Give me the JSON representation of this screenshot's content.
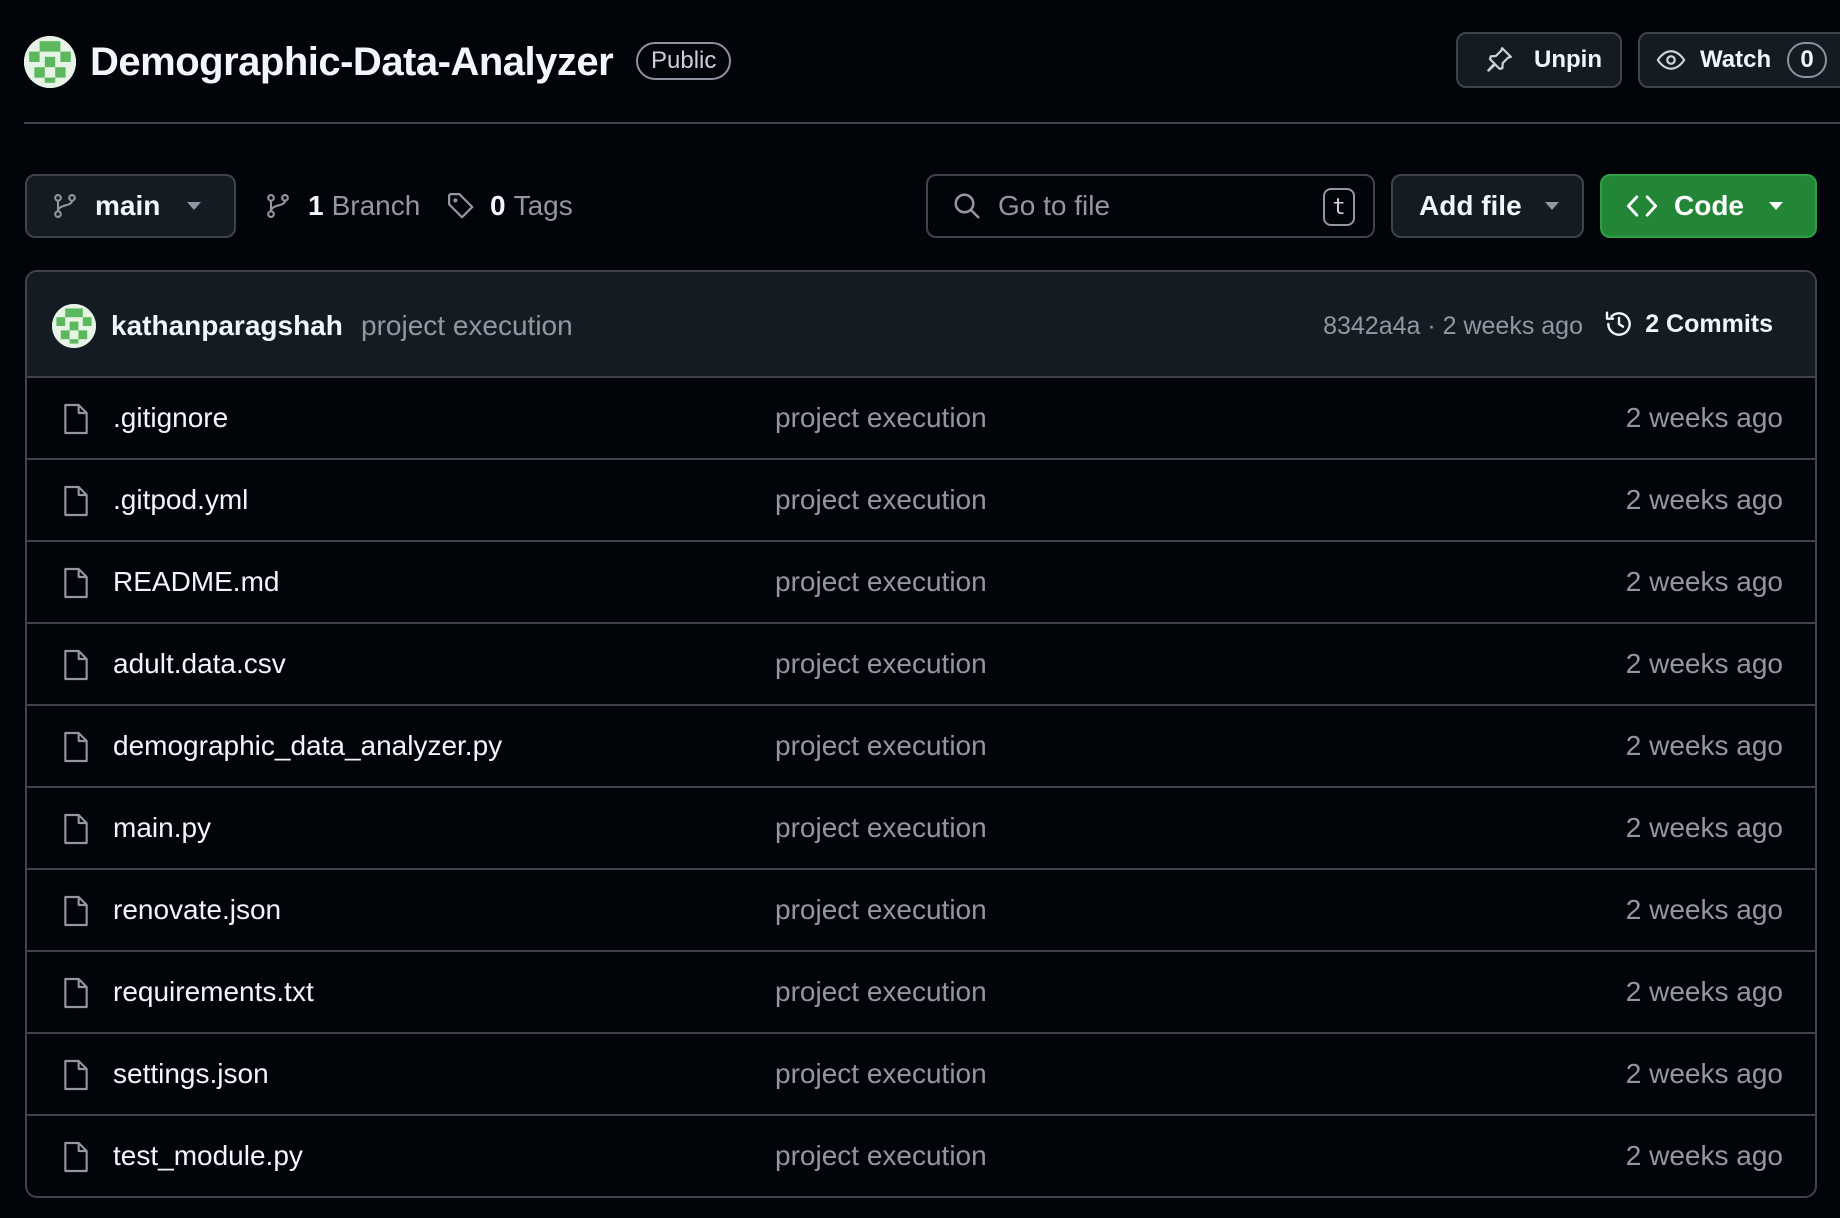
{
  "colors": {
    "background": "#010409",
    "surface": "#151b23",
    "border": "#3d444d",
    "text_primary": "#f0f6fc",
    "text_muted": "#9198a1",
    "code_button": "#238636"
  },
  "repo": {
    "name": "Demographic-Data-Analyzer",
    "visibility": "Public",
    "avatar_icon": "identicon"
  },
  "actions": {
    "unpin_label": "Unpin",
    "unpin_icon": "pin-icon",
    "watch_label": "Watch",
    "watch_icon": "eye-icon",
    "watch_count": "0"
  },
  "toolbar": {
    "branch": "main",
    "branch_count": "1",
    "branch_label": "Branch",
    "tag_count": "0",
    "tag_label": "Tags",
    "search_placeholder": "Go to file",
    "search_value": "",
    "search_shortcut": "t",
    "add_file_label": "Add file",
    "code_label": "Code"
  },
  "latest_commit": {
    "author": "kathanparagshah",
    "message": "project execution",
    "hash_and_time": "8342a4a · 2 weeks ago",
    "commits_label": "2 Commits"
  },
  "files": [
    {
      "name": ".gitignore",
      "commit": "project execution",
      "updated": "2 weeks ago"
    },
    {
      "name": ".gitpod.yml",
      "commit": "project execution",
      "updated": "2 weeks ago"
    },
    {
      "name": "README.md",
      "commit": "project execution",
      "updated": "2 weeks ago"
    },
    {
      "name": "adult.data.csv",
      "commit": "project execution",
      "updated": "2 weeks ago"
    },
    {
      "name": "demographic_data_analyzer.py",
      "commit": "project execution",
      "updated": "2 weeks ago"
    },
    {
      "name": "main.py",
      "commit": "project execution",
      "updated": "2 weeks ago"
    },
    {
      "name": "renovate.json",
      "commit": "project execution",
      "updated": "2 weeks ago"
    },
    {
      "name": "requirements.txt",
      "commit": "project execution",
      "updated": "2 weeks ago"
    },
    {
      "name": "settings.json",
      "commit": "project execution",
      "updated": "2 weeks ago"
    },
    {
      "name": "test_module.py",
      "commit": "project execution",
      "updated": "2 weeks ago"
    }
  ]
}
